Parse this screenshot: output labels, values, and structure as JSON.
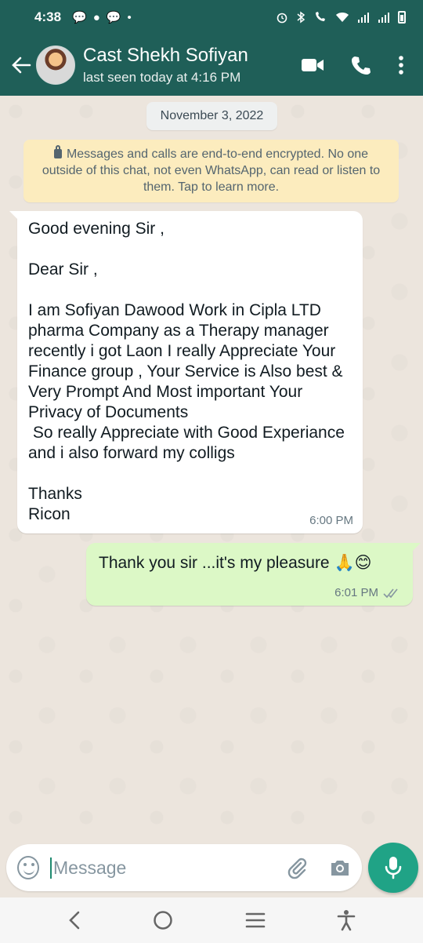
{
  "status_bar": {
    "time": "4:38"
  },
  "header": {
    "contact_name": "Cast Shekh Sofiyan",
    "last_seen": "last seen today at 4:16 PM"
  },
  "chat": {
    "date": "November 3, 2022",
    "encryption_notice": "Messages and calls are end-to-end encrypted. No one outside of this chat, not even WhatsApp, can read or listen to them. Tap to learn more.",
    "messages": [
      {
        "direction": "incoming",
        "text": "Good evening Sir ,\n\nDear Sir ,\n\nI am Sofiyan Dawood Work in Cipla LTD pharma Company as a Therapy manager recently i got Laon I really Appreciate Your Finance group , Your Service is Also best & Very Prompt And Most important Your Privacy of Documents\n So really Appreciate with Good Experiance and i also forward my colligs\n\nThanks\nRicon",
        "time": "6:00 PM"
      },
      {
        "direction": "outgoing",
        "text": "Thank you sir ...it's my pleasure 🙏😊",
        "time": "6:01 PM",
        "status_icon": "double-check-icon"
      }
    ]
  },
  "composer": {
    "placeholder": "Message"
  },
  "colors": {
    "header": "#1f5f58",
    "chat_background": "#ece5dd",
    "outgoing_bubble": "#dcf8c6",
    "incoming_bubble": "#ffffff",
    "encryption_notice": "#fcecbe",
    "mic_button": "#20a386"
  }
}
